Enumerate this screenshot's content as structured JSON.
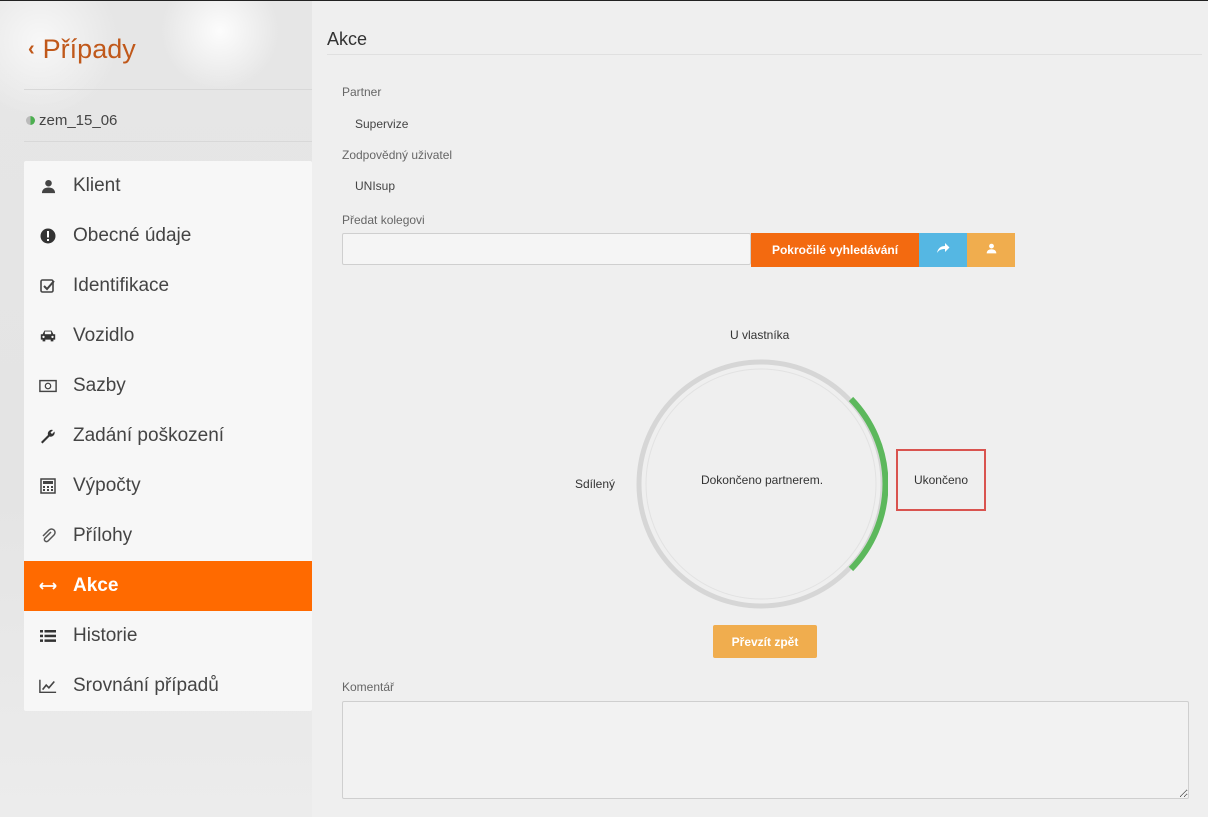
{
  "sidebar": {
    "back_label": "Případy",
    "case_id": "zem_15_06",
    "items": [
      {
        "label": "Klient",
        "icon": "user-icon"
      },
      {
        "label": "Obecné údaje",
        "icon": "exclamation-circle-icon"
      },
      {
        "label": "Identifikace",
        "icon": "check-square-icon"
      },
      {
        "label": "Vozidlo",
        "icon": "car-icon"
      },
      {
        "label": "Sazby",
        "icon": "money-icon"
      },
      {
        "label": "Zadání poškození",
        "icon": "wrench-icon"
      },
      {
        "label": "Výpočty",
        "icon": "calculator-icon"
      },
      {
        "label": "Přílohy",
        "icon": "paperclip-icon"
      },
      {
        "label": "Akce",
        "icon": "arrows-h-icon",
        "active": true
      },
      {
        "label": "Historie",
        "icon": "list-icon"
      },
      {
        "label": "Srovnání případů",
        "icon": "line-chart-icon"
      }
    ],
    "colors": {
      "accent": "#ff6a00",
      "back_link": "#c0581a"
    }
  },
  "main": {
    "title": "Akce",
    "partner_label": "Partner",
    "partner_value": "Supervize",
    "user_label": "Zodpovědný uživatel",
    "user_value": "UNIsup",
    "handover_label": "Předat kolegovi",
    "handover_value": "",
    "advanced_search_button": "Pokročilé vyhledávání",
    "workflow": {
      "top": "U vlastníka",
      "left": "Sdílený",
      "right": "Ukončeno",
      "center": "Dokončeno partnerem.",
      "progress_color": "#5cb85c",
      "track_color": "#d6d6d6"
    },
    "take_back_button": "Převzít zpět",
    "comment_label": "Komentář",
    "comment_value": ""
  }
}
